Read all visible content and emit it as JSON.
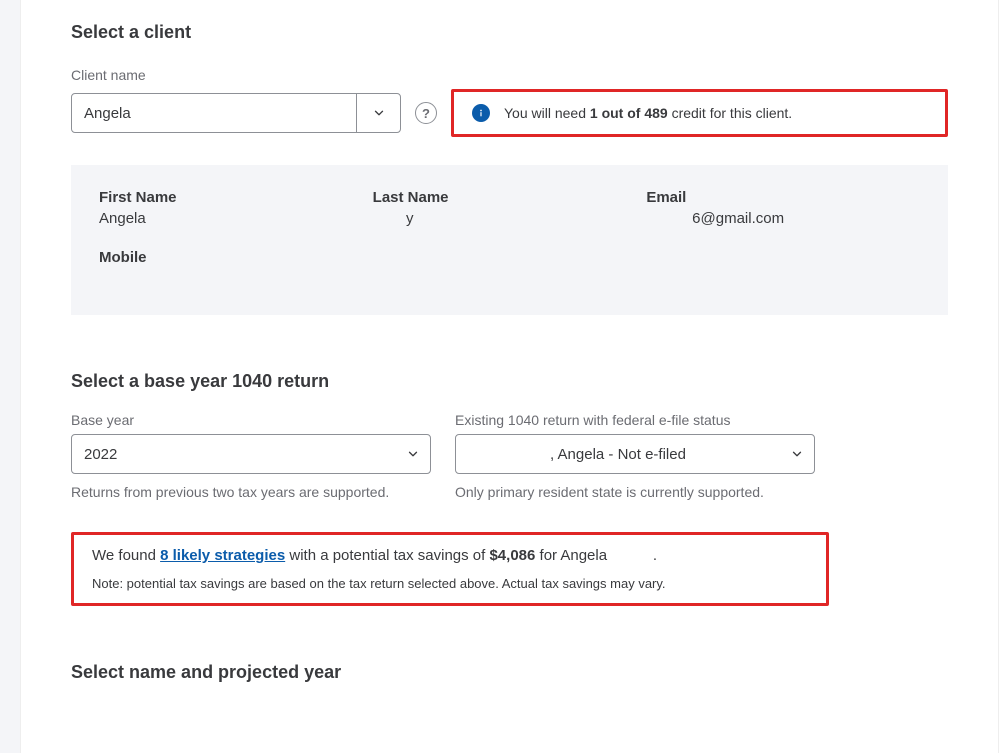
{
  "section1": {
    "title": "Select a client",
    "client_name_label": "Client name",
    "client_name_value": "Angela",
    "credit_prefix": "You will need ",
    "credit_bold": "1 out of 489",
    "credit_suffix": " credit for this client."
  },
  "client_card": {
    "first_name_label": "First Name",
    "first_name_value": "Angela",
    "last_name_label": "Last Name",
    "last_name_value": "        y",
    "email_label": "Email",
    "email_value": "           6@gmail.com",
    "mobile_label": "Mobile",
    "mobile_value": " "
  },
  "section2": {
    "title": "Select a base year 1040 return",
    "base_year_label": "Base year",
    "base_year_value": "2022",
    "base_year_helper": "Returns from previous two tax years are supported.",
    "return_label": "Existing 1040 return with federal e-file status",
    "return_value": ", Angela - Not e-filed",
    "return_helper": "Only primary resident state is currently supported."
  },
  "strategy": {
    "pre": "We found ",
    "link": "8 likely strategies",
    "mid": " with a potential tax savings of ",
    "amount": "$4,086",
    "post": " for Angela           .",
    "note": "Note: potential tax savings are based on the tax return selected above. Actual tax savings may vary."
  },
  "section3": {
    "title": "Select name and projected year"
  }
}
